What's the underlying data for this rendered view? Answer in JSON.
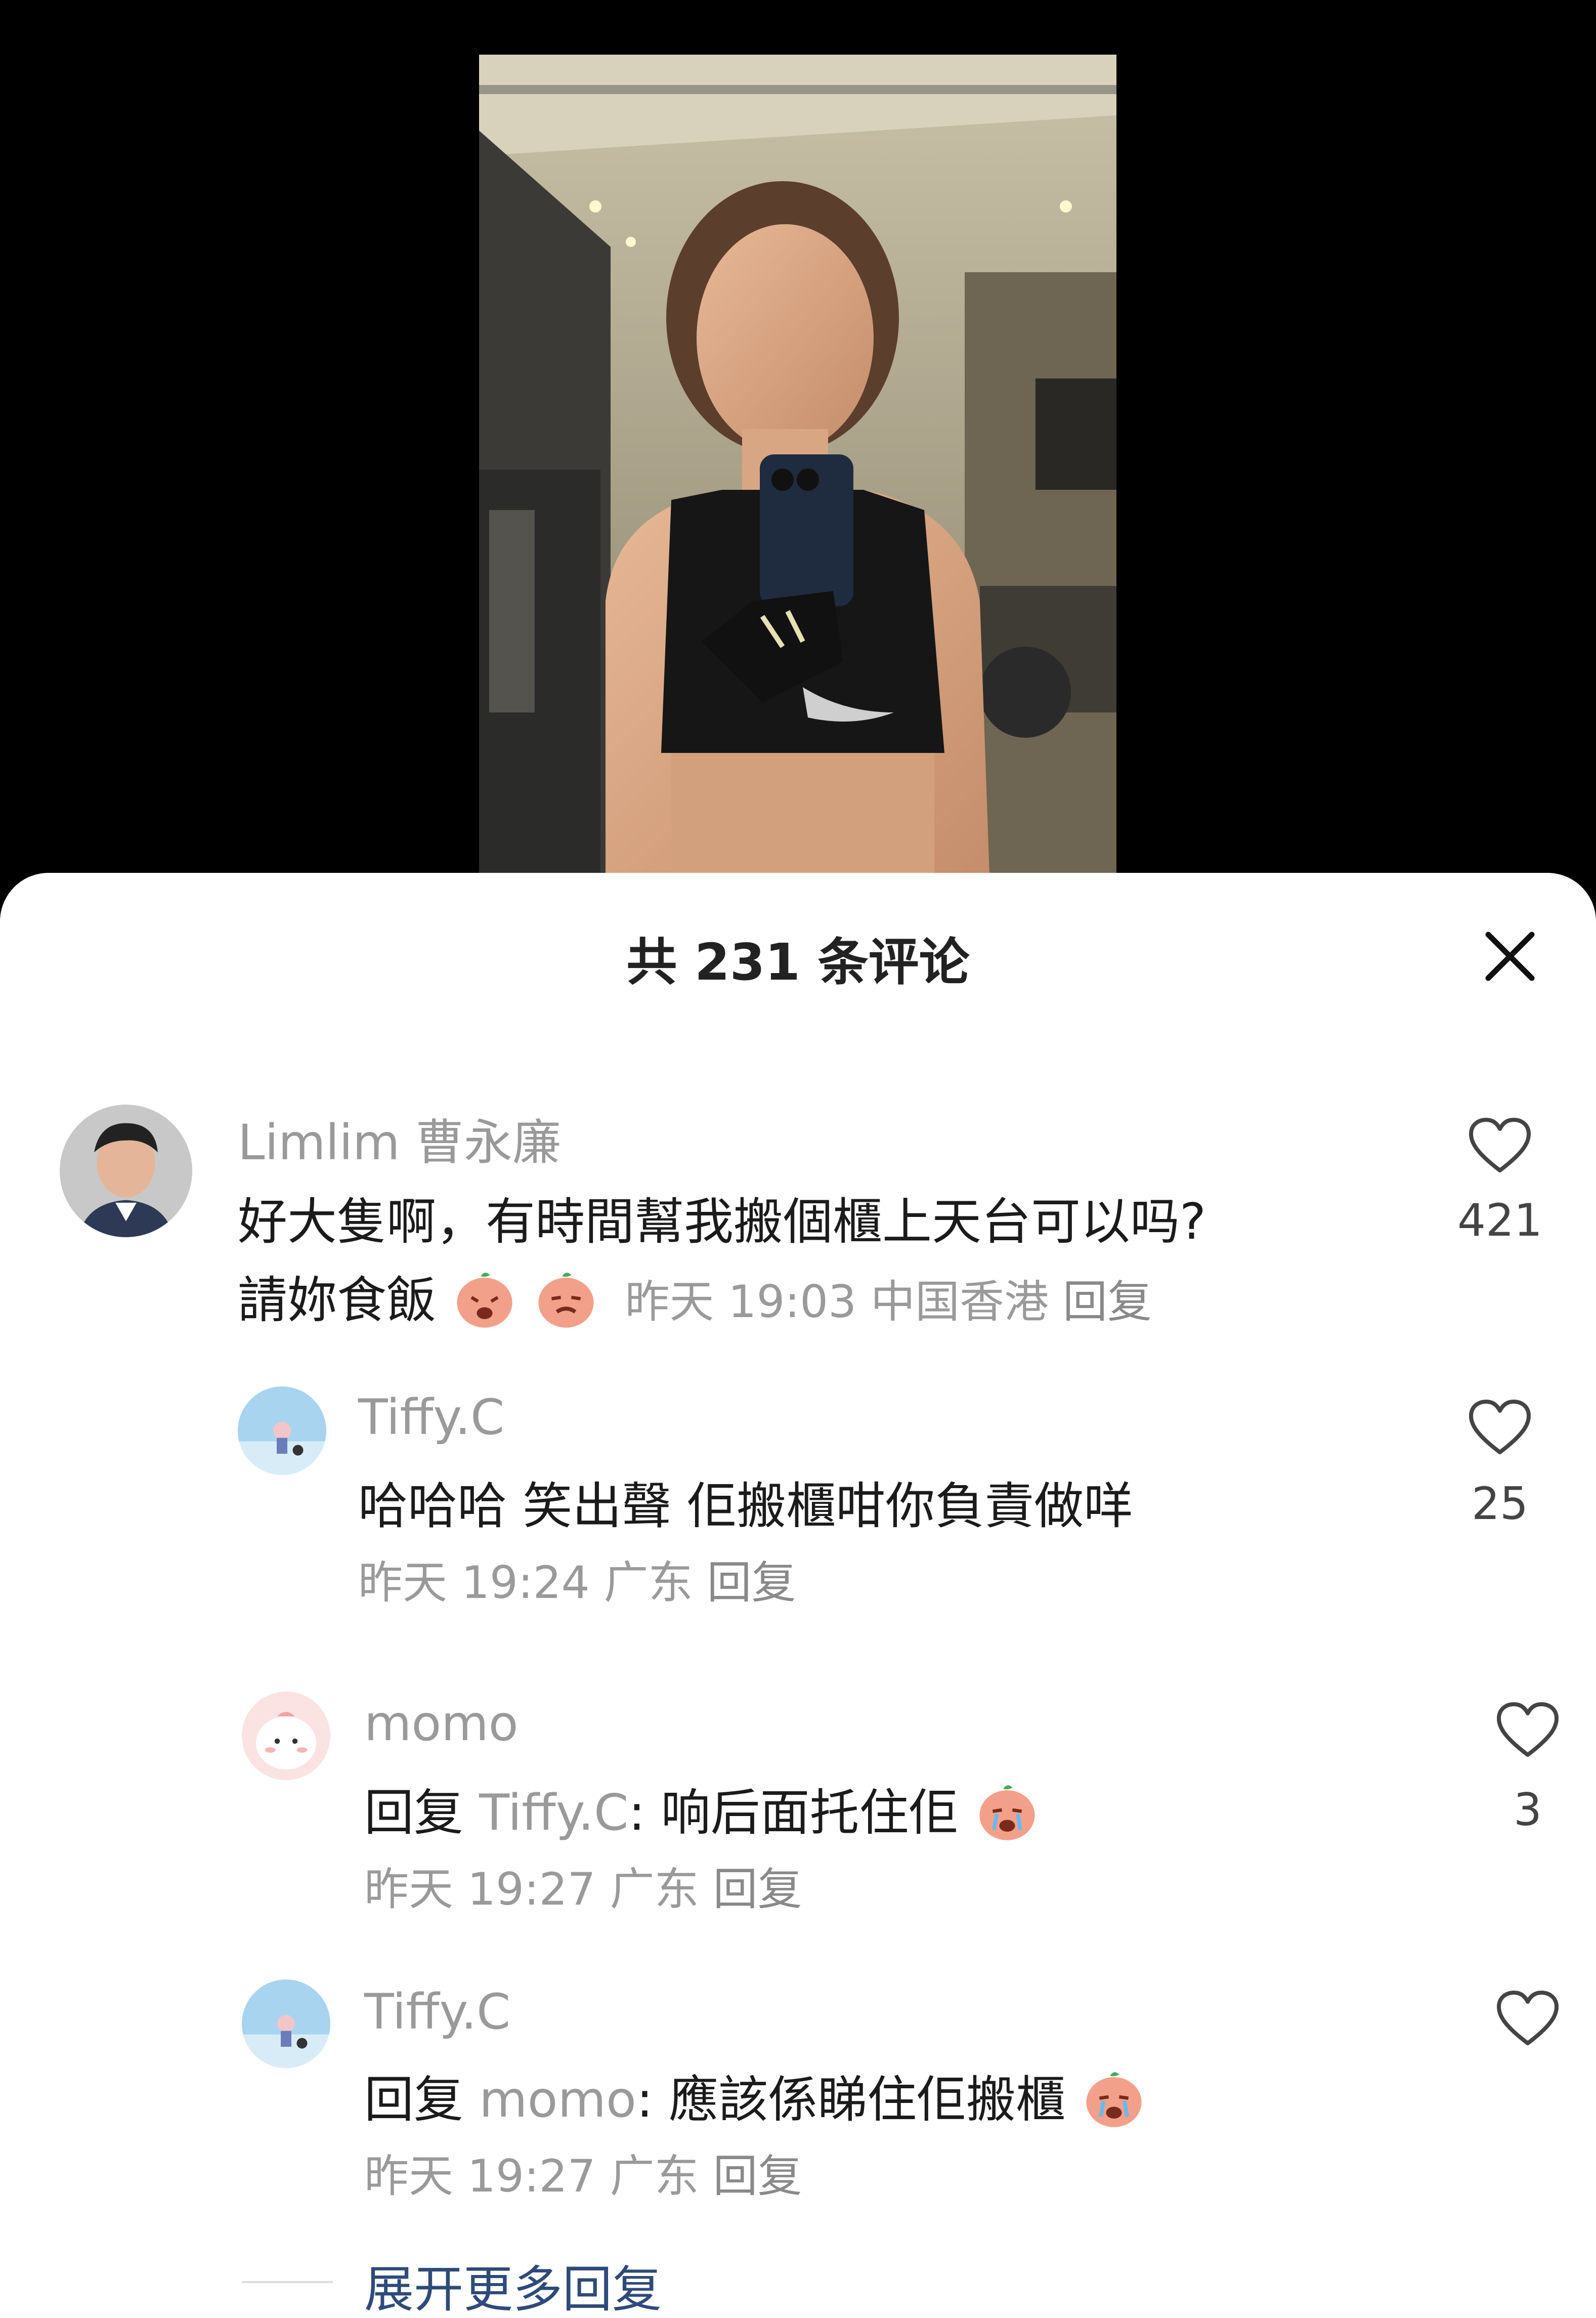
{
  "sheet": {
    "title": "共 231 条评论"
  },
  "comments": [
    {
      "user": "Limlim 曹永廉",
      "line1": "好大隻啊，有時間幫我搬個櫃上天台可以吗?",
      "line2_prefix": "請妳食飯",
      "time": "昨天 19:03",
      "location": "中国香港",
      "reply_label": "回复",
      "likes": "421"
    },
    {
      "user": "Tiffy.C",
      "text": "哈哈哈 笑出聲 佢搬櫃咁你負責做咩",
      "time": "昨天 19:24",
      "location": "广东",
      "reply_label": "回复",
      "likes": "25"
    },
    {
      "user": "momo",
      "reply_prefix": "回复",
      "reply_to": "Tiffy.C",
      "text": ": 响后面托住佢",
      "time": "昨天 19:27",
      "location": "广东",
      "reply_label": "回复",
      "likes": "3"
    },
    {
      "user": "Tiffy.C",
      "reply_prefix": "回复",
      "reply_to": "momo",
      "text": ": 應該係睇住佢搬櫃",
      "time": "昨天 19:27",
      "location": "广东",
      "reply_label": "回复",
      "likes": ""
    }
  ],
  "expand_more": "展开更多回复",
  "icons": {
    "close": "close-icon",
    "like": "heart-outline-icon",
    "emoji": "crying-peach-emoji"
  },
  "colors": {
    "username": "#9a9a9a",
    "text": "#1b1b1b",
    "link": "#2e4a7a",
    "background": "#000000"
  }
}
